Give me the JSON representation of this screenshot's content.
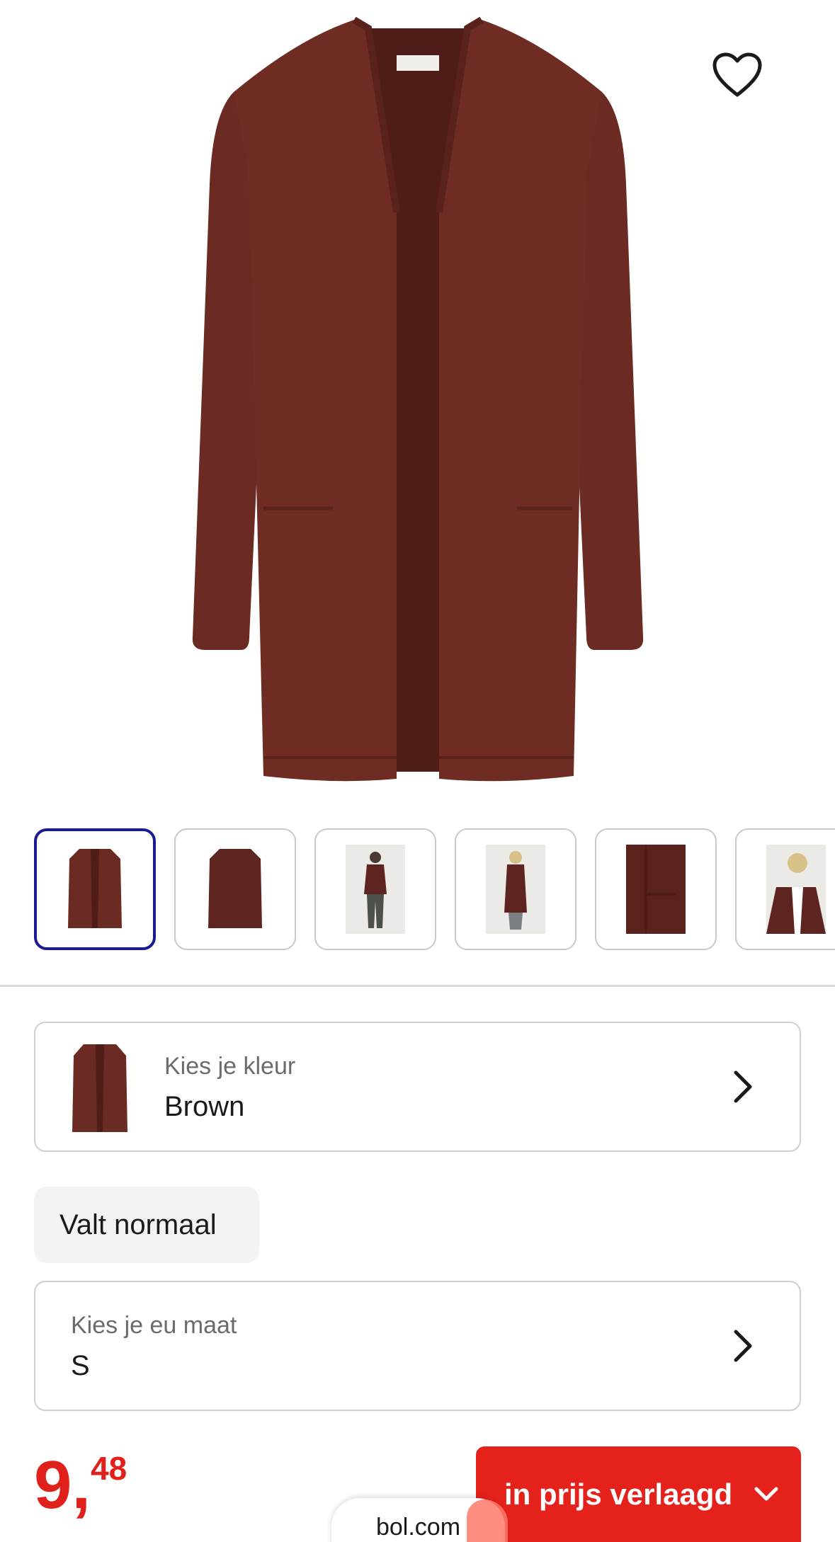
{
  "product": {
    "colors": {
      "fabric": "#6b2a22",
      "fabric_dark": "#4f1d18"
    }
  },
  "actions": {
    "favorite_icon": "heart-outline-icon"
  },
  "thumbnails": [
    {
      "name": "thumb-front",
      "selected": true
    },
    {
      "name": "thumb-back",
      "selected": false
    },
    {
      "name": "thumb-model-front",
      "selected": false
    },
    {
      "name": "thumb-model-back",
      "selected": false
    },
    {
      "name": "thumb-detail",
      "selected": false
    },
    {
      "name": "thumb-model-closeup",
      "selected": false
    }
  ],
  "color_selector": {
    "label": "Kies je kleur",
    "value": "Brown"
  },
  "fit_badge": {
    "label": "Valt normaal"
  },
  "size_selector": {
    "label": "Kies je eu maat",
    "value": "S"
  },
  "price": {
    "integer": "9",
    "separator": ",",
    "decimals": "48",
    "color": "#e0201b"
  },
  "cta": {
    "label": "in prijs verlaagd",
    "color": "#e5211b"
  },
  "branding": {
    "watermark": "bol.com"
  }
}
